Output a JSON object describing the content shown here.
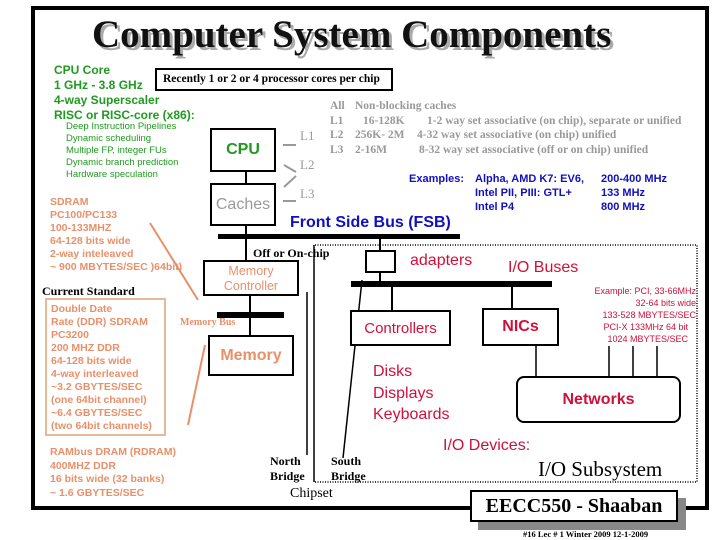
{
  "title": "Computer System Components",
  "cpu_core": {
    "lines": [
      "CPU Core",
      "1 GHz - 3.8 GHz",
      "4-way Superscaler",
      "RISC or RISC-core (x86):"
    ],
    "features": [
      "Deep Instruction Pipelines",
      "Dynamic scheduling",
      "Multiple FP, integer FUs",
      "Dynamic branch prediction",
      "Hardware speculation"
    ]
  },
  "cores_note": "Recently 1 or 2 or 4 processor cores per chip",
  "cpu_label": "CPU",
  "caches_label": "Caches",
  "cache_levels": [
    "L1",
    "L2",
    "L3"
  ],
  "cache_table": [
    [
      "All",
      "Non-blocking caches",
      ""
    ],
    [
      "L1",
      "16-128K",
      "1-2 way set associative (on chip), separate or unified"
    ],
    [
      "L2",
      "256K- 2M",
      "4-32 way set associative  (on chip) unified"
    ],
    [
      "L3",
      "2-16M",
      "8-32  way set associative  (off  or on chip) unified"
    ]
  ],
  "examples": {
    "label": "Examples:",
    "rows": [
      [
        "Alpha, AMD K7:  EV6,",
        "200-400 MHz"
      ],
      [
        "Intel  PII, PIII:  GTL+",
        "133 MHz"
      ],
      [
        "Intel P4",
        "800 MHz"
      ]
    ]
  },
  "fsb": "Front Side Bus (FSB)",
  "sdram": [
    "SDRAM",
    "PC100/PC133",
    "100-133MHZ",
    "64-128 bits wide",
    "2-way inteleaved",
    "~ 900 MBYTES/SEC )64bit)"
  ],
  "off_on_chip": "Off or On-chip",
  "memory_controller": [
    "Memory",
    "Controller"
  ],
  "current_standard": "Current Standard",
  "ddr": [
    "Double Date",
    "Rate  (DDR) SDRAM",
    "PC3200",
    "200 MHZ  DDR",
    "64-128 bits wide",
    "4-way interleaved",
    "~3.2  GBYTES/SEC",
    "(one 64bit channel)",
    "~6.4  GBYTES/SEC",
    "(two 64bit channels)"
  ],
  "memory_bus": "Memory Bus",
  "memory": "Memory",
  "rambus": [
    "RAMbus DRAM (RDRAM)",
    "400MHZ DDR",
    "16 bits wide (32 banks)",
    "~ 1.6 GBYTES/SEC"
  ],
  "adapters": "adapters",
  "io_buses": "I/O Buses",
  "pci_example": [
    "Example:  PCI,  33-66MHz",
    "32-64 bits wide",
    "133-528 MBYTES/SEC",
    "PCI-X 133MHz 64 bit",
    "1024 MBYTES/SEC"
  ],
  "controllers": "Controllers",
  "nics": "NICs",
  "devices": [
    "Disks",
    "Displays",
    "Keyboards"
  ],
  "networks": "Networks",
  "io_devices": "I/O Devices:",
  "io_subsystem": "I/O Subsystem",
  "north_bridge": [
    "North",
    "Bridge"
  ],
  "south_bridge": [
    "South",
    "Bridge"
  ],
  "chipset": "Chipset",
  "footer_box": "EECC550 - Shaaban",
  "footer": "#16   Lec # 1  Winter 2009  12-1-2009"
}
